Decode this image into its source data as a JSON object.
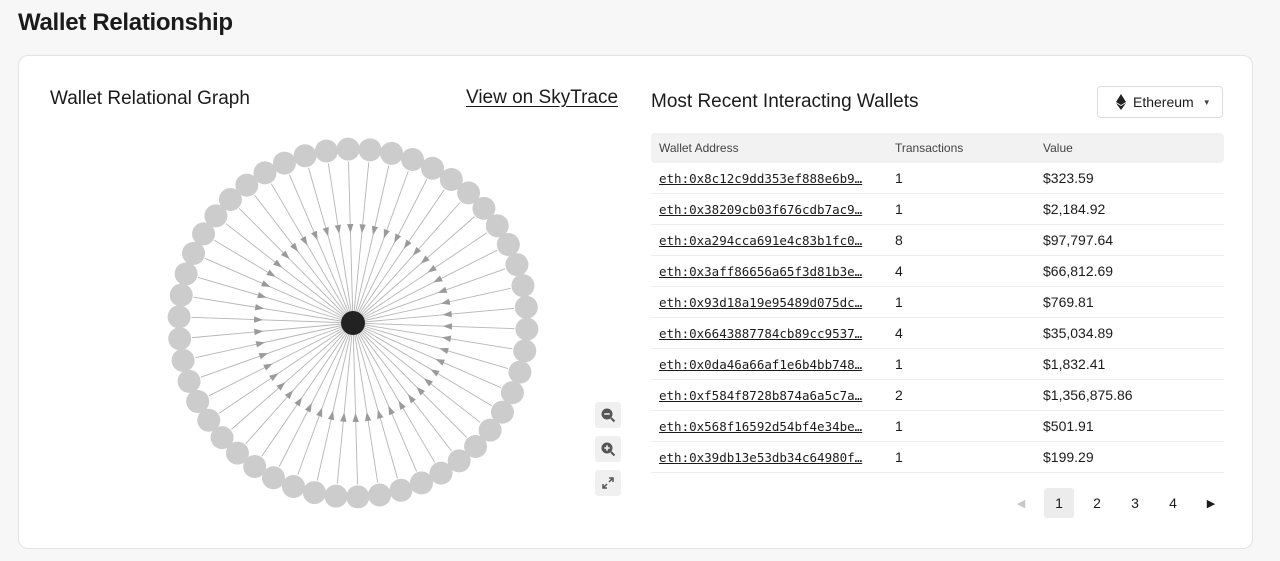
{
  "page": {
    "title": "Wallet Relationship"
  },
  "graph": {
    "title": "Wallet Relational Graph",
    "link_label": "View on SkyTrace",
    "center_node_color": "#222222",
    "peer_node_color": "#cccccc",
    "peer_count": 50,
    "controls": [
      "zoom-out-icon",
      "zoom-in-icon",
      "fit-screen-icon"
    ]
  },
  "wallets": {
    "title": "Most Recent Interacting Wallets",
    "chain_select": {
      "value": "Ethereum",
      "icon": "ethereum-icon"
    },
    "columns": [
      "Wallet Address",
      "Transactions",
      "Value"
    ],
    "rows": [
      {
        "address": "eth:0x8c12c9dd353ef888e6b9…",
        "transactions": "1",
        "value": "$323.59"
      },
      {
        "address": "eth:0x38209cb03f676cdb7ac9…",
        "transactions": "1",
        "value": "$2,184.92"
      },
      {
        "address": "eth:0xa294cca691e4c83b1fc0…",
        "transactions": "8",
        "value": "$97,797.64"
      },
      {
        "address": "eth:0x3aff86656a65f3d81b3e…",
        "transactions": "4",
        "value": "$66,812.69"
      },
      {
        "address": "eth:0x93d18a19e95489d075dc…",
        "transactions": "1",
        "value": "$769.81"
      },
      {
        "address": "eth:0x6643887784cb89cc9537…",
        "transactions": "4",
        "value": "$35,034.89"
      },
      {
        "address": "eth:0x0da46a66af1e6b4bb748…",
        "transactions": "1",
        "value": "$1,832.41"
      },
      {
        "address": "eth:0xf584f8728b874a6a5c7a…",
        "transactions": "2",
        "value": "$1,356,875.86"
      },
      {
        "address": "eth:0x568f16592d54bf4e34be…",
        "transactions": "1",
        "value": "$501.91"
      },
      {
        "address": "eth:0x39db13e53db34c64980f…",
        "transactions": "1",
        "value": "$199.29"
      }
    ],
    "pagination": {
      "pages": [
        "1",
        "2",
        "3",
        "4"
      ],
      "current": "1"
    }
  }
}
